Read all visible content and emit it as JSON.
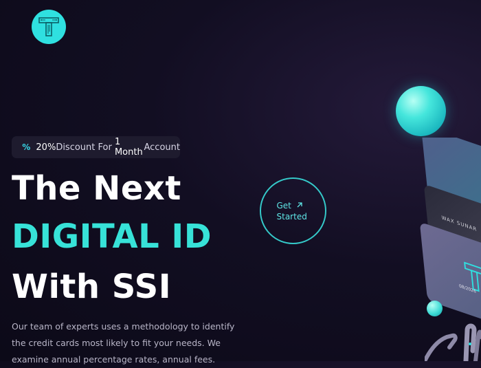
{
  "brand": {
    "logo_icon": "circuit-t-logo",
    "accent": "#2fe0e0"
  },
  "promo": {
    "icon": "percent-icon",
    "percent": "20%",
    "text_mid": "Discount For ",
    "months": "1 Month",
    "text_end": "Account"
  },
  "hero": {
    "line1": "The Next",
    "line2": "DIGITAL ID",
    "line3": "With SSI",
    "description": "Our team of experts uses a methodology to identify the credit cards most likely to fit your needs. We examine annual percentage rates, annual fees."
  },
  "cta": {
    "line1": "Get",
    "line2": "Started",
    "icon": "arrow-up-right-icon"
  },
  "cards": {
    "name": "WAX SUNAR",
    "date": "08/2026"
  },
  "colors": {
    "highlight": "#37e2d8",
    "background": "#0c0a18"
  }
}
